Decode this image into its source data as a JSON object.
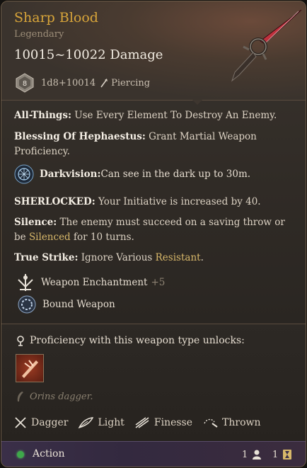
{
  "item": {
    "name": "Sharp Blood",
    "rarity": "Legendary",
    "damage": "10015~10022 Damage",
    "die_face": "8",
    "dice_formula": "1d8+10014",
    "damage_type": "Piercing"
  },
  "properties": {
    "all_things_name": "All-Things:",
    "all_things_desc": " Use Every Element To Destroy An Enemy.",
    "hephaestus_name": "Blessing Of Hephaestus:",
    "hephaestus_desc": " Grant Martial Weapon Proficiency.",
    "darkvision_name": "Darkvision:",
    "darkvision_desc": " Can see in the dark up to 30m.",
    "sherlocked_name": "SHERLOCKED:",
    "sherlocked_desc": " Your Initiative is increased by 40.",
    "silence_name": "Silence:",
    "silence_desc1": " The enemy must succeed on a saving throw or be ",
    "silence_hl": "Silenced",
    "silence_desc2": " for 10 turns.",
    "truestrike_name": "True Strike:",
    "truestrike_desc": " Ignore Various ",
    "truestrike_hl": "Resistant",
    "truestrike_end": "."
  },
  "enchantment": {
    "label": "Weapon Enchantment",
    "bonus": "+5"
  },
  "bound": {
    "label": "Bound Weapon"
  },
  "proficiency": {
    "label": "Proficiency with this weapon type unlocks:"
  },
  "description": "Orins dagger.",
  "weapon_props": [
    "Dagger",
    "Light",
    "Finesse",
    "Thrown"
  ],
  "footer": {
    "action": "Action",
    "action_cost": "1",
    "bonus_cost": "1"
  },
  "colors": {
    "title": "#d8a53a",
    "action_dot": "#3ea84a"
  }
}
